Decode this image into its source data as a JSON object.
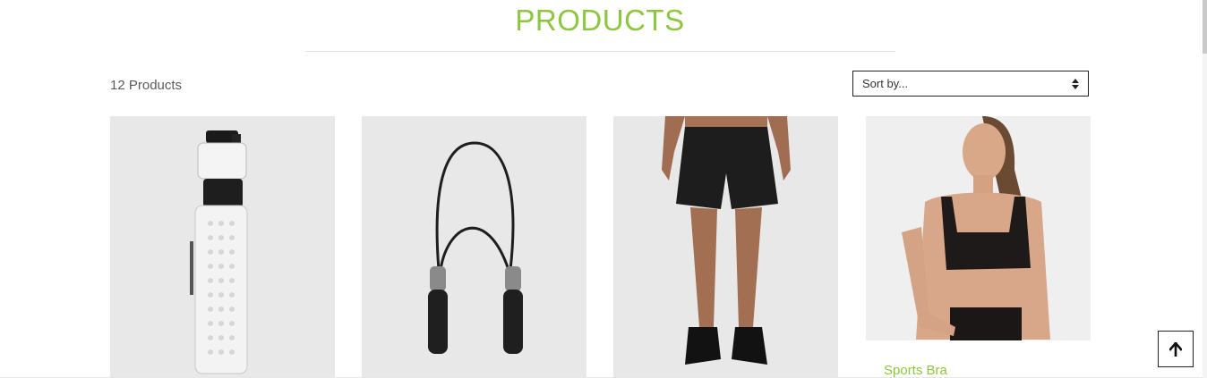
{
  "page": {
    "title": "PRODUCTS"
  },
  "toolbar": {
    "count": "12 Products",
    "sort_value": "Sort by..."
  },
  "colors": {
    "accent": "#8dc63f",
    "card_bg": "#e8e8e8"
  },
  "products": [
    {
      "image": "water-bottle"
    },
    {
      "image": "jump-rope"
    },
    {
      "image": "black-shorts"
    },
    {
      "image": "sports-bra",
      "name": "Sports Bra"
    }
  ],
  "icons": {
    "scroll_top": "arrow-up-icon",
    "sort": "sort-arrows-icon"
  }
}
